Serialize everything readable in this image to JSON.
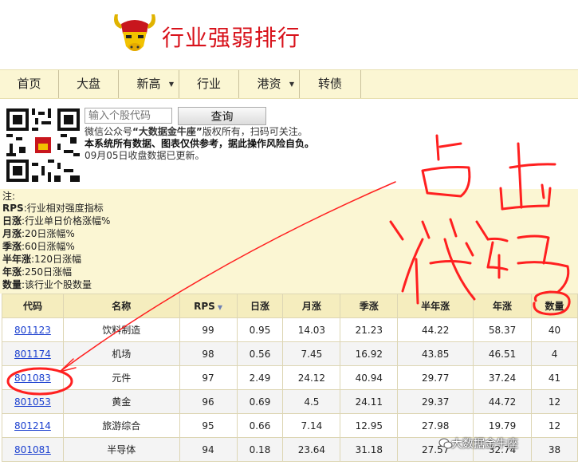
{
  "site": {
    "title": "行业强弱排行"
  },
  "nav": {
    "items": [
      {
        "label": "首页",
        "dropdown": false
      },
      {
        "label": "大盘",
        "dropdown": false
      },
      {
        "label": "新高",
        "dropdown": true
      },
      {
        "label": "行业",
        "dropdown": false
      },
      {
        "label": "港资",
        "dropdown": true
      },
      {
        "label": "转债",
        "dropdown": false
      }
    ]
  },
  "search": {
    "placeholder": "输入个股代码",
    "button": "查询"
  },
  "info": {
    "line1_pre": "微信公众号",
    "line1_brand": "“大数据金牛座”",
    "line1_post": "版权所有，扫码可关注。",
    "line2": "本系统所有数据、图表仅供参考，据此操作风险自负。",
    "line3": "09月05日收盘数据已更新。"
  },
  "notes": {
    "heading": "注:",
    "items": [
      {
        "key": "RPS",
        "text": ":行业相对强度指标"
      },
      {
        "key": "日涨",
        "text": ":行业单日价格涨幅%"
      },
      {
        "key": "月涨",
        "text": ":20日涨幅%"
      },
      {
        "key": "季涨",
        "text": ":60日涨幅%"
      },
      {
        "key": "半年涨",
        "text": ":120日涨幅"
      },
      {
        "key": "年涨",
        "text": ":250日涨幅"
      },
      {
        "key": "数量",
        "text": ":该行业个股数量"
      }
    ]
  },
  "table": {
    "headers": [
      "代码",
      "名称",
      "RPS",
      "日涨",
      "月涨",
      "季涨",
      "半年涨",
      "年涨",
      "数量"
    ],
    "rows": [
      [
        "801123",
        "饮料制造",
        "99",
        "0.95",
        "14.03",
        "21.23",
        "44.22",
        "58.37",
        "40"
      ],
      [
        "801174",
        "机场",
        "98",
        "0.56",
        "7.45",
        "16.92",
        "43.85",
        "46.51",
        "4"
      ],
      [
        "801083",
        "元件",
        "97",
        "2.49",
        "24.12",
        "40.94",
        "29.77",
        "37.24",
        "41"
      ],
      [
        "801053",
        "黄金",
        "96",
        "0.69",
        "4.5",
        "24.11",
        "29.37",
        "44.72",
        "12"
      ],
      [
        "801214",
        "旅游综合",
        "95",
        "0.66",
        "7.14",
        "12.95",
        "27.98",
        "19.79",
        "12"
      ],
      [
        "801081",
        "半导体",
        "94",
        "0.18",
        "23.64",
        "31.18",
        "27.57",
        "32.74",
        "38"
      ]
    ]
  },
  "annotation": {
    "handwriting": [
      "点",
      "击",
      "代",
      "码"
    ],
    "color": "#ff2020"
  },
  "watermark": {
    "text": "大数据金牛座"
  }
}
